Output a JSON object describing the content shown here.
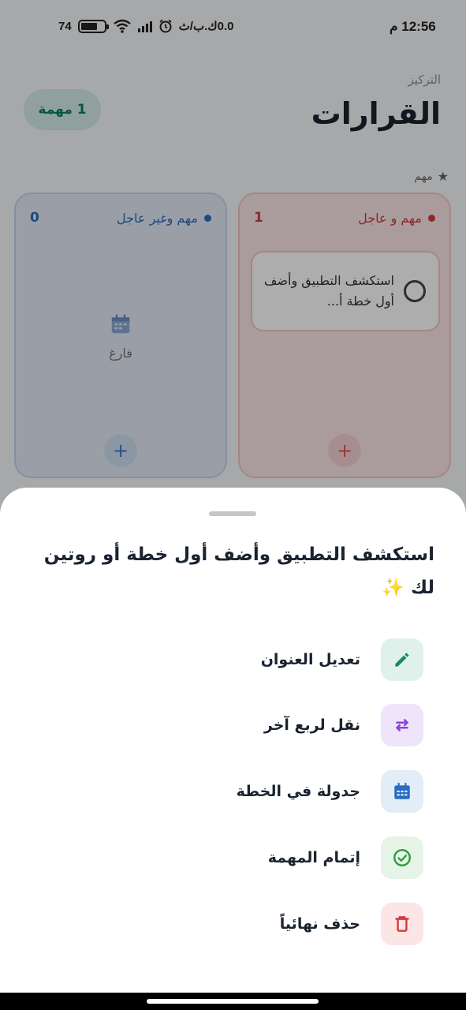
{
  "status_bar": {
    "time": "12:56 م",
    "speed": "0.0ك.ب/ث",
    "battery": "74",
    "battery_level_percent": 74
  },
  "header": {
    "breadcrumb": "التركيز",
    "title": "القرارات",
    "task_count": "1 مهمة"
  },
  "filter": {
    "label": "مهم",
    "icon": "star-icon"
  },
  "quadrants": [
    {
      "label": "مهم و عاجل",
      "count": "1",
      "color": "#d23a3a",
      "tasks": [
        {
          "text": "استكشف التطبيق وأضف أول خطة أ..."
        }
      ]
    },
    {
      "label": "مهم وغير عاجل",
      "count": "0",
      "color": "#2a6cc0",
      "empty_label": "فارغ"
    }
  ],
  "sheet": {
    "title": "استكشف التطبيق وأضف أول خطة أو روتين لك ✨",
    "options": [
      {
        "label": "تعديل العنوان",
        "icon": "pencil-icon",
        "color": "#138a6c",
        "bg": "#e0f1ec"
      },
      {
        "label": "نقل لربع آخر",
        "icon": "swap-arrows-icon",
        "color": "#8b45d6",
        "bg": "#efe5fb"
      },
      {
        "label": "جدولة في الخطة",
        "icon": "calendar-icon",
        "color": "#2a6cc0",
        "bg": "#e3edf8"
      },
      {
        "label": "إتمام المهمة",
        "icon": "check-circle-icon",
        "color": "#2e9c3e",
        "bg": "#e5f4e6"
      },
      {
        "label": "حذف نهائياً",
        "icon": "trash-icon",
        "color": "#d63a3a",
        "bg": "#fbe5e5"
      }
    ]
  }
}
